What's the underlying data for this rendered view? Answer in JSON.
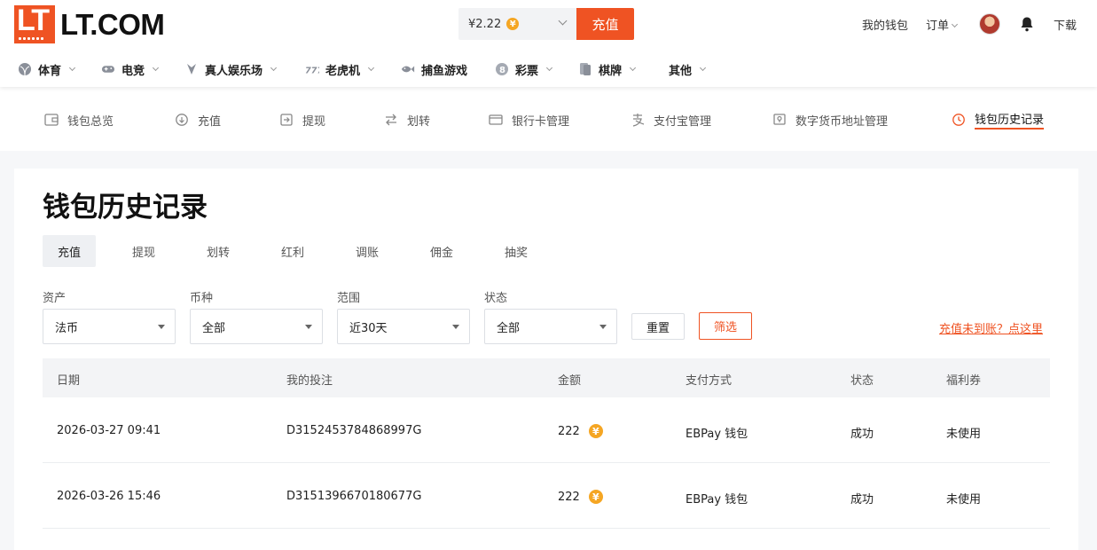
{
  "brand": {
    "logo_letters": "LT",
    "name": "LT.COM",
    "color": "#ef5323"
  },
  "header": {
    "balance": "¥2.22",
    "currency_icon": "yen-coin-icon",
    "deposit_label": "充值",
    "my_wallet": "我的钱包",
    "orders": "订单",
    "download": "下载"
  },
  "categories": [
    {
      "label": "体育",
      "icon": "sports-ball-icon"
    },
    {
      "label": "电竞",
      "icon": "gamepad-icon"
    },
    {
      "label": "真人娱乐场",
      "icon": "dealer-icon"
    },
    {
      "label": "老虎机",
      "icon": "slot-icon"
    },
    {
      "label": "捕鱼游戏",
      "icon": "fish-icon"
    },
    {
      "label": "彩票",
      "icon": "lottery-icon"
    },
    {
      "label": "棋牌",
      "icon": "cards-icon"
    },
    {
      "label": "其他",
      "icon": ""
    }
  ],
  "wallet_nav": [
    {
      "label": "钱包总览",
      "icon": "wallet-icon"
    },
    {
      "label": "充值",
      "icon": "deposit-icon"
    },
    {
      "label": "提现",
      "icon": "withdraw-icon"
    },
    {
      "label": "划转",
      "icon": "transfer-icon"
    },
    {
      "label": "银行卡管理",
      "icon": "bank-card-icon"
    },
    {
      "label": "支付宝管理",
      "icon": "alipay-icon"
    },
    {
      "label": "数字货币地址管理",
      "icon": "crypto-address-icon"
    },
    {
      "label": "钱包历史记录",
      "icon": "clock-icon",
      "active": true
    }
  ],
  "page": {
    "title": "钱包历史记录",
    "tabs": [
      "充值",
      "提现",
      "划转",
      "红利",
      "调账",
      "佣金",
      "抽奖"
    ],
    "active_tab": "充值"
  },
  "filters": {
    "asset_label": "资产",
    "asset_value": "法币",
    "currency_label": "币种",
    "currency_value": "全部",
    "range_label": "范围",
    "range_value": "近30天",
    "status_label": "状态",
    "status_value": "全部",
    "reset_label": "重置",
    "filter_label": "筛选",
    "help_link": "充值未到账？点这里"
  },
  "table": {
    "headers": [
      "日期",
      "我的投注",
      "金额",
      "支付方式",
      "状态",
      "福利券"
    ],
    "rows": [
      {
        "date": "2026-03-27 09:41",
        "id": "D3152453784868997G",
        "amount": "222",
        "method": "EBPay 钱包",
        "status": "成功",
        "coupon": "未使用"
      },
      {
        "date": "2026-03-26 15:46",
        "id": "D3151396670180677G",
        "amount": "222",
        "method": "EBPay 钱包",
        "status": "成功",
        "coupon": "未使用"
      }
    ]
  }
}
